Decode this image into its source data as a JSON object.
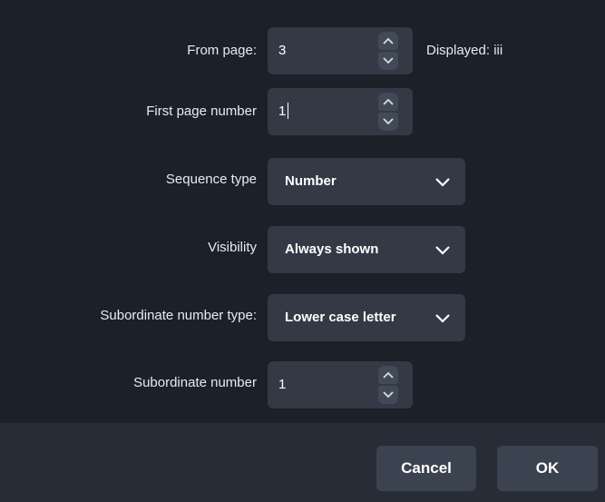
{
  "fields": {
    "from_page": {
      "label": "From page:",
      "value": "3",
      "displayed": "Displayed: iii"
    },
    "first_page_number": {
      "label": "First page number",
      "value": "1"
    },
    "sequence_type": {
      "label": "Sequence type",
      "value": "Number"
    },
    "visibility": {
      "label": "Visibility",
      "value": "Always shown"
    },
    "subordinate_number_type": {
      "label": "Subordinate number type:",
      "value": "Lower case letter"
    },
    "subordinate_number": {
      "label": "Subordinate number",
      "value": "1"
    }
  },
  "buttons": {
    "cancel": "Cancel",
    "ok": "OK"
  },
  "icons": {
    "spin_up": "chevron-up-icon",
    "spin_down": "chevron-down-icon",
    "dropdown": "chevron-down-icon"
  },
  "colors": {
    "background": "#1c2028",
    "control": "#333a46",
    "footer": "#272c36",
    "button": "#3b4350"
  }
}
